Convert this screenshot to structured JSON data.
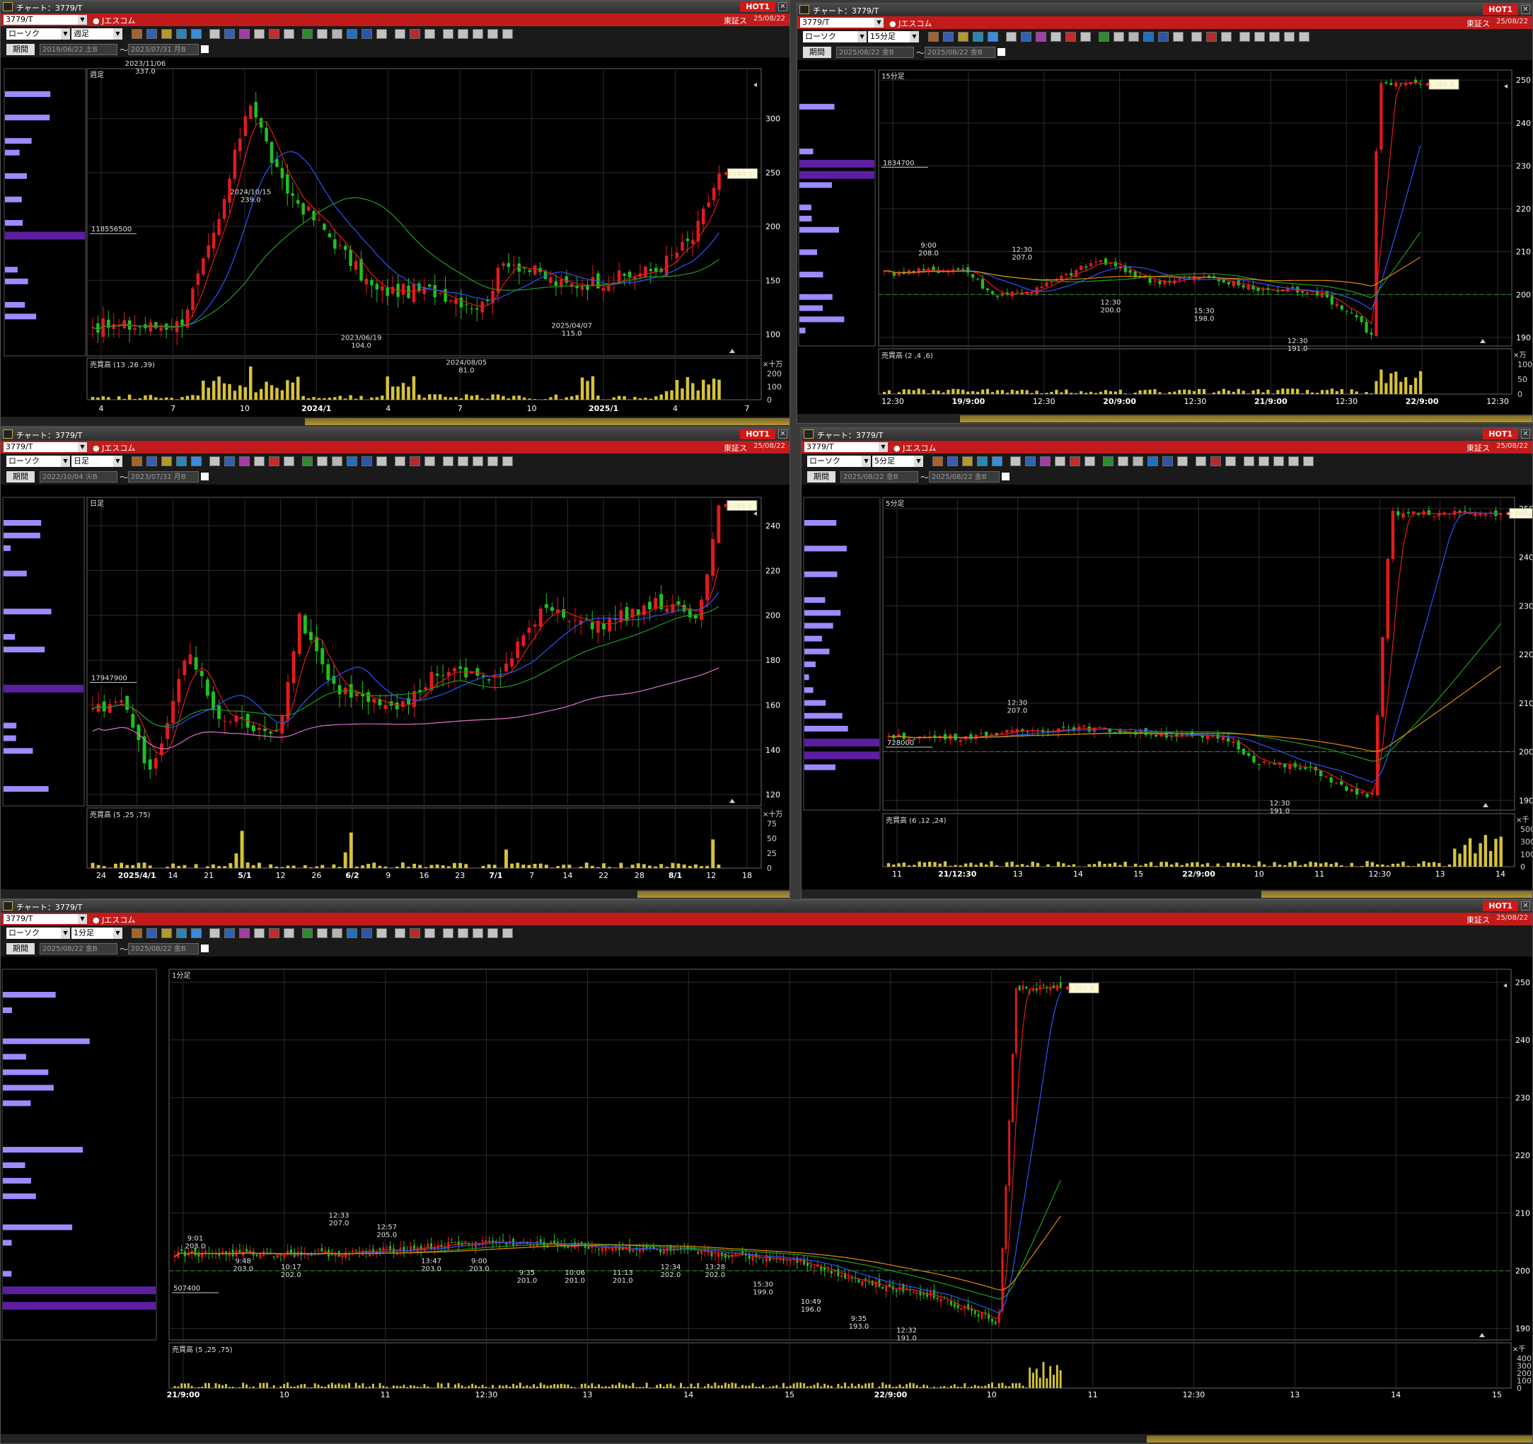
{
  "common": {
    "title": "チャート：3779/T",
    "hot": "HOT1",
    "symbol": "3779/T",
    "name": "Jエスコム",
    "market": "東証ス",
    "date": "25/08/22",
    "chart_type": "ローソク",
    "period_button": "期間",
    "price_tag": "249.0",
    "colors": {
      "up": "#e21b1b",
      "down": "#1ec21e",
      "ma_short": "#e21b1b",
      "ma_mid": "#2a55ff",
      "ma_long": "#1e9e1e",
      "ma_vwap": "#e08a00",
      "volume": "#d6c23a",
      "profile": "#9b8cff",
      "profile_peak": "#5b1fa0"
    }
  },
  "panels": [
    {
      "id": "weekly",
      "interval": "週足",
      "from": "2019/06/22 土B",
      "to": "2023/07/31 月B",
      "chart_label": "週足",
      "profile_value": "118556500",
      "volume_label": "売買高 (13 ,26 ,39)",
      "volume_unit": "×十万",
      "y_ticks": [
        "300",
        "250",
        "200",
        "150",
        "100"
      ],
      "vol_ticks": [
        "200",
        "100",
        "0"
      ],
      "x_ticks": [
        "4",
        "7",
        "10",
        "2024/1",
        "4",
        "7",
        "10",
        "2025/1",
        "4",
        "7"
      ],
      "annotations": [
        {
          "t": "2023/11/06",
          "v": "337.0"
        },
        {
          "t": "2024/10/15",
          "v": "239.0"
        },
        {
          "t": "2023/06/19",
          "v": "104.0"
        },
        {
          "t": "2024/08/05",
          "v": "81.0"
        },
        {
          "t": "2025/04/07",
          "v": "115.0"
        }
      ]
    },
    {
      "id": "m15",
      "interval": "15分足",
      "from": "2025/08/22 金B",
      "to": "2025/08/22 金B",
      "chart_label": "15分足",
      "profile_value": "1834700",
      "volume_label": "売買高 (2 ,4 ,6)",
      "volume_unit": "×万",
      "y_ticks": [
        "250",
        "240",
        "230",
        "220",
        "210",
        "200",
        "190"
      ],
      "vol_ticks": [
        "100",
        "50",
        "0"
      ],
      "x_ticks": [
        "12:30",
        "19/9:00",
        "12:30",
        "20/9:00",
        "12:30",
        "21/9:00",
        "12:30",
        "22/9:00",
        "12:30"
      ],
      "annotations": [
        {
          "t": "9:00",
          "v": "208.0"
        },
        {
          "t": "12:30",
          "v": "207.0"
        },
        {
          "t": "12:30",
          "v": "200.0"
        },
        {
          "t": "15:30",
          "v": "198.0"
        },
        {
          "t": "12:30",
          "v": "191.0"
        }
      ]
    },
    {
      "id": "daily",
      "interval": "日足",
      "from": "2022/10/04 火B",
      "to": "2023/07/31 月B",
      "chart_label": "日足",
      "profile_value": "17947900",
      "volume_label": "売買高 (5 ,25 ,75)",
      "volume_unit": "×十万",
      "y_ticks": [
        "240",
        "220",
        "200",
        "180",
        "160",
        "140",
        "120"
      ],
      "vol_ticks": [
        "75",
        "50",
        "25",
        "0"
      ],
      "x_ticks": [
        "24",
        "2025/4/1",
        "14",
        "21",
        "5/1",
        "12",
        "26",
        "6/2",
        "9",
        "16",
        "23",
        "7/1",
        "7",
        "14",
        "22",
        "28",
        "8/1",
        "12",
        "18"
      ]
    },
    {
      "id": "m5",
      "interval": "5分足",
      "from": "2025/08/22 金B",
      "to": "2025/08/22 金B",
      "chart_label": "5分足",
      "profile_value": "728000",
      "volume_label": "売買高 (6 ,12 ,24)",
      "volume_unit": "×千",
      "y_ticks": [
        "250",
        "240",
        "230",
        "220",
        "210",
        "200",
        "190"
      ],
      "vol_ticks": [
        "500",
        "300",
        "100",
        "0"
      ],
      "x_ticks": [
        "11",
        "21/12:30",
        "13",
        "14",
        "15",
        "22/9:00",
        "10",
        "11",
        "12:30",
        "13",
        "14"
      ],
      "annotations": [
        {
          "t": "12:30",
          "v": "207.0"
        },
        {
          "t": "12:30",
          "v": "191.0"
        }
      ]
    },
    {
      "id": "m1",
      "interval": "1分足",
      "from": "2025/08/22 金B",
      "to": "2025/08/22 金B",
      "chart_label": "1分足",
      "profile_value": "507400",
      "volume_label": "売買高 (5 ,25 ,75)",
      "volume_unit": "×千",
      "y_ticks": [
        "250",
        "240",
        "230",
        "220",
        "210",
        "200",
        "190"
      ],
      "vol_ticks": [
        "400",
        "300",
        "200",
        "100",
        "0"
      ],
      "x_ticks": [
        "21/9:00",
        "10",
        "11",
        "12:30",
        "13",
        "14",
        "15",
        "22/9:00",
        "10",
        "11",
        "12:30",
        "13",
        "14",
        "15"
      ],
      "annotations": [
        {
          "t": "9:01",
          "v": "203.0"
        },
        {
          "t": "9:48",
          "v": "203.0"
        },
        {
          "t": "10:17",
          "v": "202.0"
        },
        {
          "t": "12:33",
          "v": "207.0"
        },
        {
          "t": "12:57",
          "v": "205.0"
        },
        {
          "t": "13:47",
          "v": "203.0"
        },
        {
          "t": "9:00",
          "v": "203.0"
        },
        {
          "t": "9:35",
          "v": "201.0"
        },
        {
          "t": "10:06",
          "v": "201.0"
        },
        {
          "t": "11:13",
          "v": "201.0"
        },
        {
          "t": "12:34",
          "v": "202.0"
        },
        {
          "t": "13:28",
          "v": "202.0"
        },
        {
          "t": "15:30",
          "v": "199.0"
        },
        {
          "t": "10:49",
          "v": "196.0"
        },
        {
          "t": "9:35",
          "v": "193.0"
        },
        {
          "t": "12:32",
          "v": "191.0"
        }
      ]
    }
  ]
}
